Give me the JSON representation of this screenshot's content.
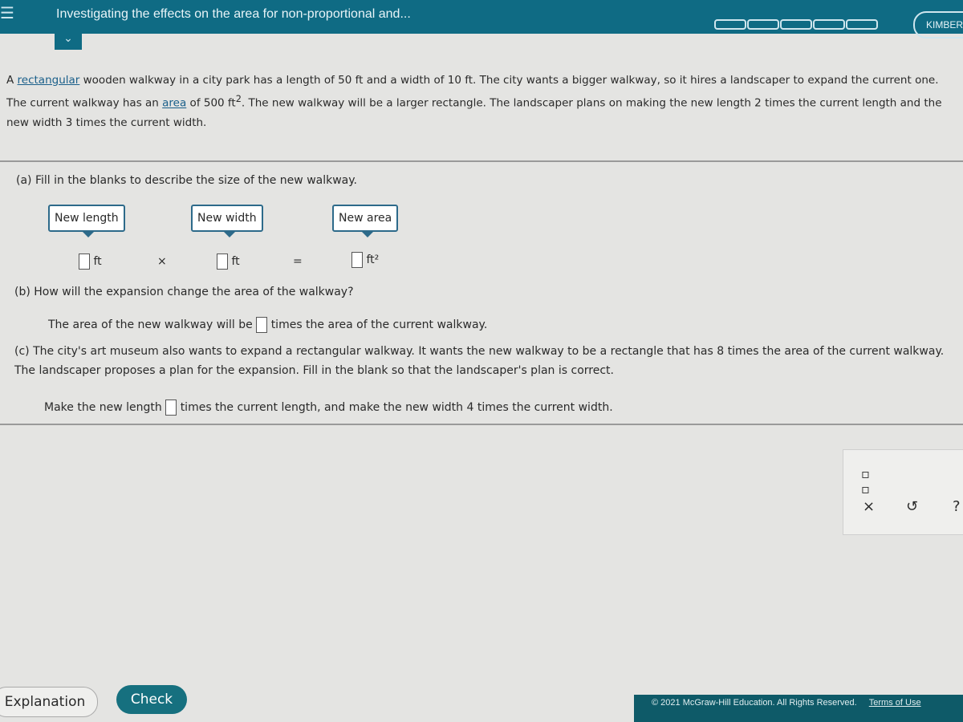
{
  "header": {
    "title": "Investigating the effects on the area for non-proportional and...",
    "user": "KIMBER",
    "menu_icon": "hamburger-icon",
    "progress_segments": 5
  },
  "prompt": {
    "p1": "A ",
    "link1": "rectangular",
    "p2": " wooden walkway in a city park has a length of 50 ft and a width of 10 ft. The city wants a bigger walkway, so it hires a landscaper to expand the current one. The current walkway has an ",
    "link2": "area",
    "p3": " of 500 ft",
    "sup": "2",
    "p4": ". The new walkway will be a larger rectangle. The landscaper plans on making the new length 2 times the current length and the new width 3 times the current width."
  },
  "part_a": {
    "question": "(a)  Fill in the blanks to describe the size of the new walkway.",
    "labels": [
      "New length",
      "New width",
      "New area"
    ],
    "unit": "ft",
    "unit_sq": "ft²",
    "times": "×",
    "equals": "="
  },
  "part_b": {
    "question": "(b)  How will the expansion change the area of the walkway?",
    "pre": "The area of the new walkway will be",
    "post": "times the area of the current walkway."
  },
  "part_c": {
    "question": "(c)  The city's art museum also wants to expand a rectangular walkway. It wants the new walkway to be a rectangle that has 8 times the area of the current walkway. The landscaper proposes a plan for the expansion. Fill in the blank so that the landscaper's plan is correct.",
    "pre": "Make the new length",
    "post": "times the current length, and make the new width 4 times the current width."
  },
  "tools": {
    "fraction": "fraction-icon",
    "clear": "×",
    "undo": "↺",
    "help": "?"
  },
  "buttons": {
    "explanation": "Explanation",
    "check": "Check"
  },
  "footer": {
    "copyright": "© 2021 McGraw-Hill Education. All Rights Reserved.",
    "terms": "Terms of Use"
  }
}
